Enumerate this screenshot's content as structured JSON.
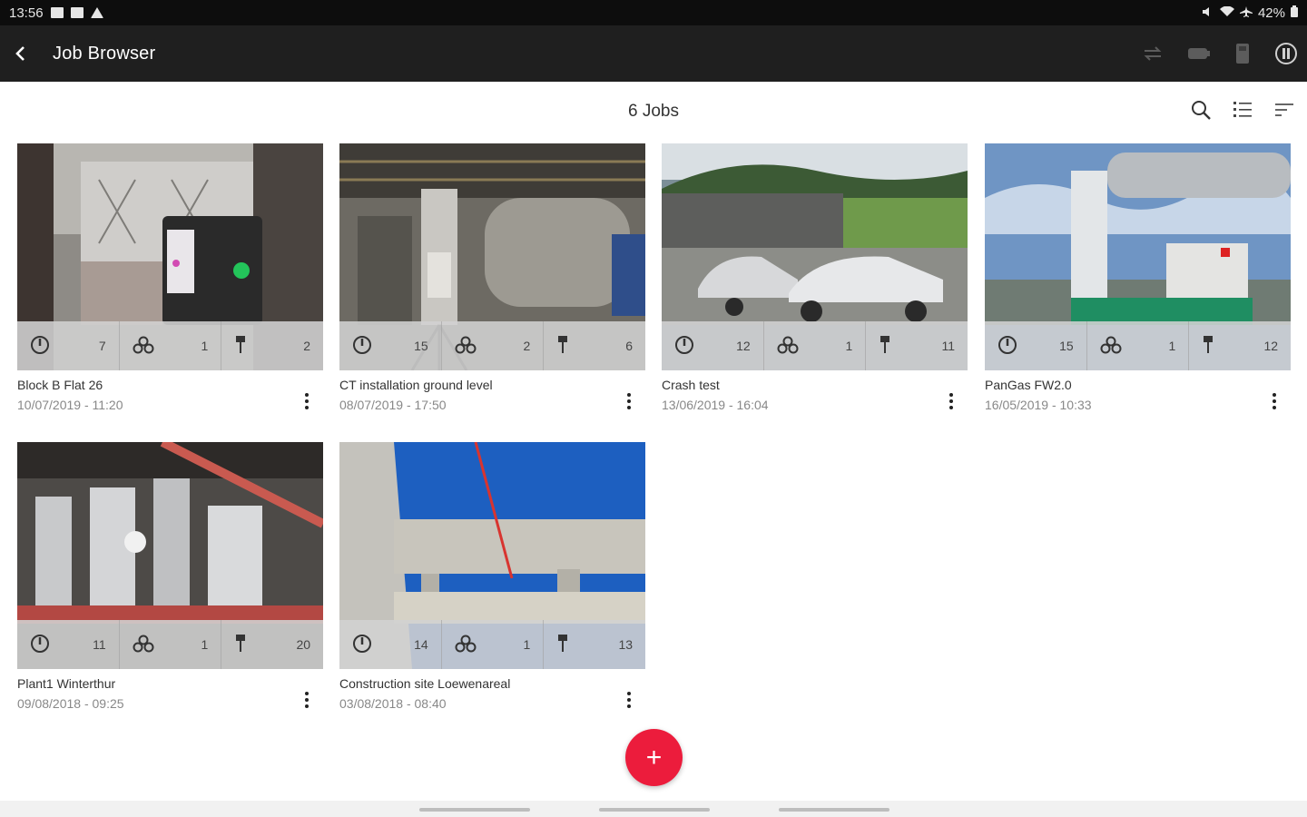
{
  "status_bar": {
    "time": "13:56",
    "battery": "42%"
  },
  "app_bar": {
    "title": "Job Browser",
    "icons": [
      "back-arrow-icon",
      "sync-icon",
      "scanner-battery-icon",
      "device-icon",
      "info-icon"
    ]
  },
  "toolbar": {
    "jobs_count": "6 Jobs",
    "icons": [
      "search-icon",
      "list-view-icon",
      "sort-icon"
    ]
  },
  "jobs": [
    {
      "name": "Block B Flat 26",
      "date": "10/07/2019 - 11:20",
      "setups": "7",
      "links": "1",
      "targets": "2"
    },
    {
      "name": "CT installation ground level",
      "date": "08/07/2019 - 17:50",
      "setups": "15",
      "links": "2",
      "targets": "6"
    },
    {
      "name": "Crash test",
      "date": "13/06/2019 - 16:04",
      "setups": "12",
      "links": "1",
      "targets": "11"
    },
    {
      "name": "PanGas FW2.0",
      "date": "16/05/2019 - 10:33",
      "setups": "15",
      "links": "1",
      "targets": "12"
    },
    {
      "name": "Plant1 Winterthur",
      "date": "09/08/2018 - 09:25",
      "setups": "11",
      "links": "1",
      "targets": "20"
    },
    {
      "name": "Construction site Loewenareal",
      "date": "03/08/2018 - 08:40",
      "setups": "14",
      "links": "1",
      "targets": "13"
    }
  ],
  "fab": {
    "label": "+"
  },
  "colors": {
    "accent": "#ec1c3c",
    "app_bar": "#1f1f1f",
    "status_bar": "#0d0d0d"
  }
}
